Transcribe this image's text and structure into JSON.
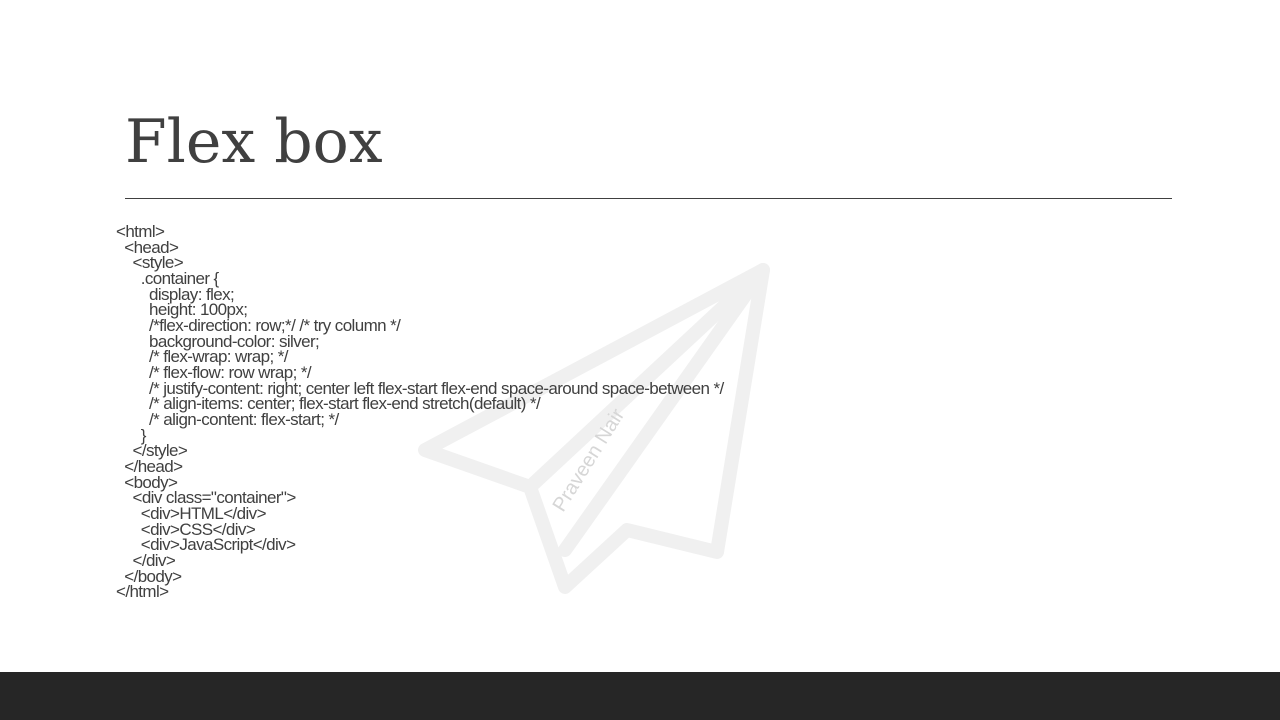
{
  "slide": {
    "title": "Flex box",
    "watermark_text": "Praveen Nair",
    "watermark_icon": "paper-plane-icon",
    "colors": {
      "text": "#404040",
      "rule": "#404040",
      "footer": "#262626",
      "watermark": "#f0f0f0"
    },
    "code_lines": [
      "<html>",
      "  <head>",
      "    <style>",
      "      .container {",
      "        display: flex;",
      "        height: 100px;",
      "        /*flex-direction: row;*/ /* try column */",
      "        background-color: silver;",
      "        /* flex-wrap: wrap; */",
      "        /* flex-flow: row wrap; */",
      "        /* justify-content: right; center left flex-start flex-end space-around space-between */",
      "        /* align-items: center; flex-start flex-end stretch(default) */",
      "        /* align-content: flex-start; */",
      "      }",
      "    </style>",
      "  </head>",
      "  <body>",
      "    <div class=\"container\">",
      "      <div>HTML</div>",
      "      <div>CSS</div>",
      "      <div>JavaScript</div>",
      "    </div>",
      "  </body>",
      "</html>"
    ]
  }
}
